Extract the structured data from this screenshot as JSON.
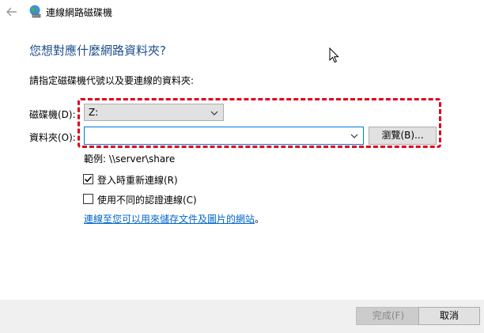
{
  "window": {
    "title": "連線網路磁碟機",
    "back_icon": "back-arrow-icon",
    "app_icon": "network-drive-icon"
  },
  "heading": "您想對應什麼網路資料夾?",
  "subheading": "請指定磁碟機代號以及要連線的資料夾:",
  "drive": {
    "label": "磁碟機(D):",
    "value": "Z:"
  },
  "folder": {
    "label": "資料夾(O):",
    "value": "",
    "placeholder": ""
  },
  "browse_button": "瀏覽(B)...",
  "example": "範例: \\\\server\\share",
  "options": {
    "reconnect": {
      "label": "登入時重新連線(R)",
      "checked": true
    },
    "different_credentials": {
      "label": "使用不同的認證連線(C)",
      "checked": false
    }
  },
  "link": {
    "text": "連線至您可以用來儲存文件及圖片的網站",
    "suffix": "。"
  },
  "footer": {
    "finish": "完成(F)",
    "cancel": "取消"
  },
  "colors": {
    "heading": "#1e4e8c",
    "link": "#0066cc",
    "highlight": "#e0001b",
    "input_border": "#0078d7"
  }
}
